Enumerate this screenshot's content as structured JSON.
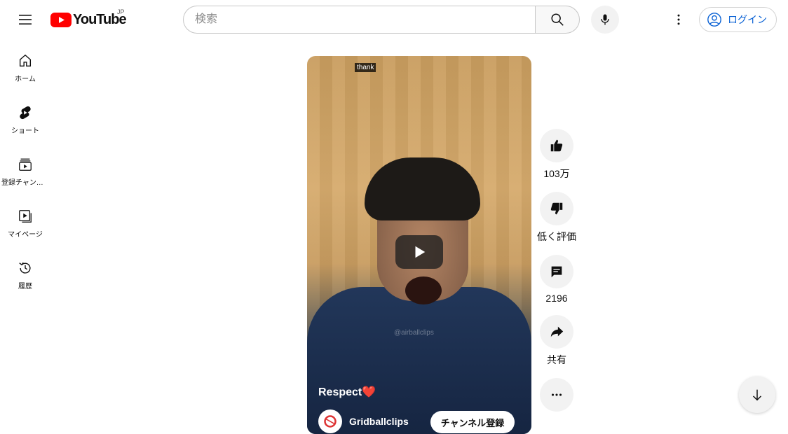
{
  "header": {
    "logo_text": "YouTube",
    "region": "JP",
    "search_placeholder": "検索",
    "login_label": "ログイン"
  },
  "sidebar": {
    "items": [
      {
        "label": "ホーム",
        "icon": "home-icon"
      },
      {
        "label": "ショート",
        "icon": "shorts-icon"
      },
      {
        "label": "登録チャンネル",
        "icon": "subscriptions-icon"
      },
      {
        "label": "マイページ",
        "icon": "library-icon"
      },
      {
        "label": "履歴",
        "icon": "history-icon"
      }
    ]
  },
  "video": {
    "caption": "thank",
    "watermark": "@airballclips",
    "title": "Respect",
    "title_emoji": "❤️",
    "channel_name": "Gridballclips",
    "subscribe_label": "チャンネル登録"
  },
  "actions": {
    "like_count": "103万",
    "dislike_label": "低く評価",
    "comment_count": "2196",
    "share_label": "共有"
  },
  "colors": {
    "brand_red": "#ff0000",
    "link_blue": "#065fd4"
  }
}
